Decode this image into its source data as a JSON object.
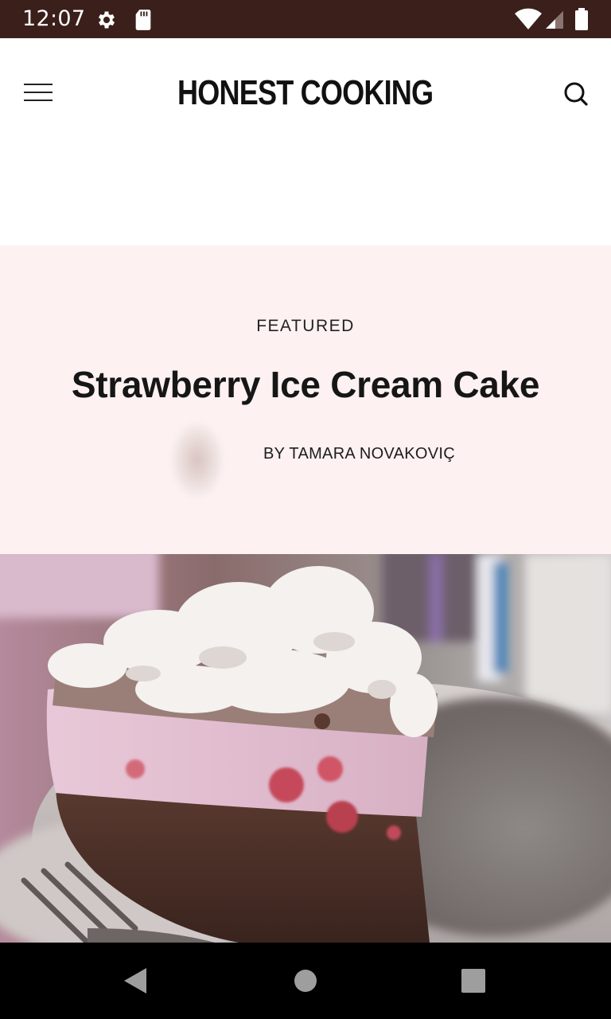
{
  "status_bar": {
    "time": "12:07",
    "icons": [
      "settings-icon",
      "sd-card-icon",
      "wifi-icon",
      "cell-signal-icon",
      "battery-icon"
    ]
  },
  "header": {
    "logo_text": "HONEST COOKING",
    "menu_icon": "hamburger-menu-icon",
    "search_icon": "search-icon"
  },
  "featured": {
    "label": "FEATURED",
    "title": "Strawberry Ice Cream Cake",
    "byline_prefix": "BY",
    "author": "TAMARA NOVAKOVIÇ"
  },
  "nav_bar": {
    "buttons": [
      "back-icon",
      "home-icon",
      "recents-icon"
    ]
  },
  "colors": {
    "status_bar_bg": "#3b1f1a",
    "hero_bg": "#fdf1f1",
    "nav_bar_bg": "#000000"
  }
}
